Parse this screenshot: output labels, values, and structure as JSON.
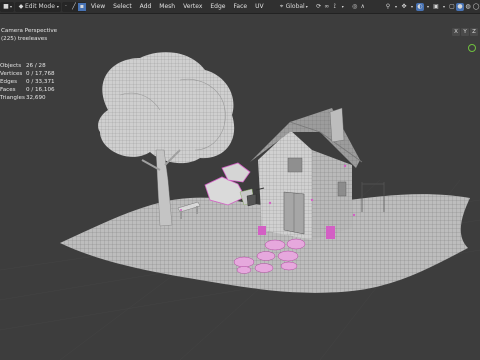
{
  "header": {
    "mode": "Edit Mode",
    "menus": [
      "View",
      "Select",
      "Add",
      "Mesh",
      "Vertex",
      "Edge",
      "Face",
      "UV"
    ],
    "transform_orientation": "Global"
  },
  "navigation": {
    "x": "X",
    "y": "Y",
    "z": "Z"
  },
  "viewport": {
    "view_name": "Camera Perspective",
    "object_line": "(225) treeleaves"
  },
  "stats": [
    {
      "label": "Objects",
      "value": "26 / 28"
    },
    {
      "label": "Vertices",
      "value": "0 / 17,768"
    },
    {
      "label": "Edges",
      "value": "0 / 33,371"
    },
    {
      "label": "Faces",
      "value": "0 / 16,106"
    },
    {
      "label": "Triangles",
      "value": "32,690"
    }
  ],
  "colors": {
    "accent": "#4772b3",
    "selection_pink": "#d35fc4",
    "background": "#3d3d3d"
  }
}
